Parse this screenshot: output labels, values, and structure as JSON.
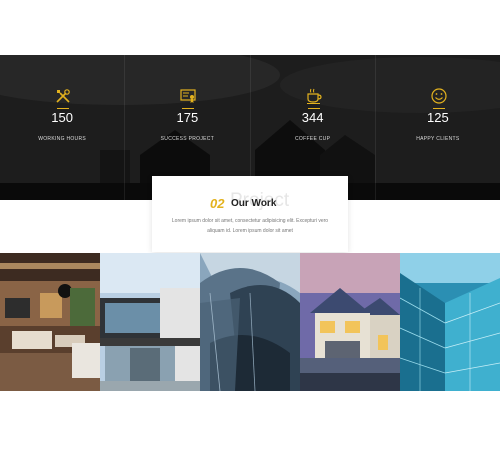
{
  "stats": [
    {
      "icon": "tools-icon",
      "value": "150",
      "label": "WORKING HOURS"
    },
    {
      "icon": "certificate-icon",
      "value": "175",
      "label": "SUCCESS PROJECT"
    },
    {
      "icon": "coffee-cup-icon",
      "value": "344",
      "label": "COFFEE CUP"
    },
    {
      "icon": "smile-icon",
      "value": "125",
      "label": "HAPPY CLIENTS"
    }
  ],
  "section": {
    "index": "02",
    "title": "Our Work",
    "ghost": "Project",
    "description": "Lorem ipsum dolor sit amet, consectetur adipisicing elit. Excepturi vero aliquam id. Lorem ipsum dolor sit amet"
  },
  "gallery": [
    {
      "name": "interior-living-room-image"
    },
    {
      "name": "modern-house-image"
    },
    {
      "name": "curved-building-image"
    },
    {
      "name": "suburban-house-image"
    },
    {
      "name": "glass-tower-image"
    }
  ],
  "colors": {
    "accent": "#e3b21e",
    "dark": "#1a1a1a"
  }
}
